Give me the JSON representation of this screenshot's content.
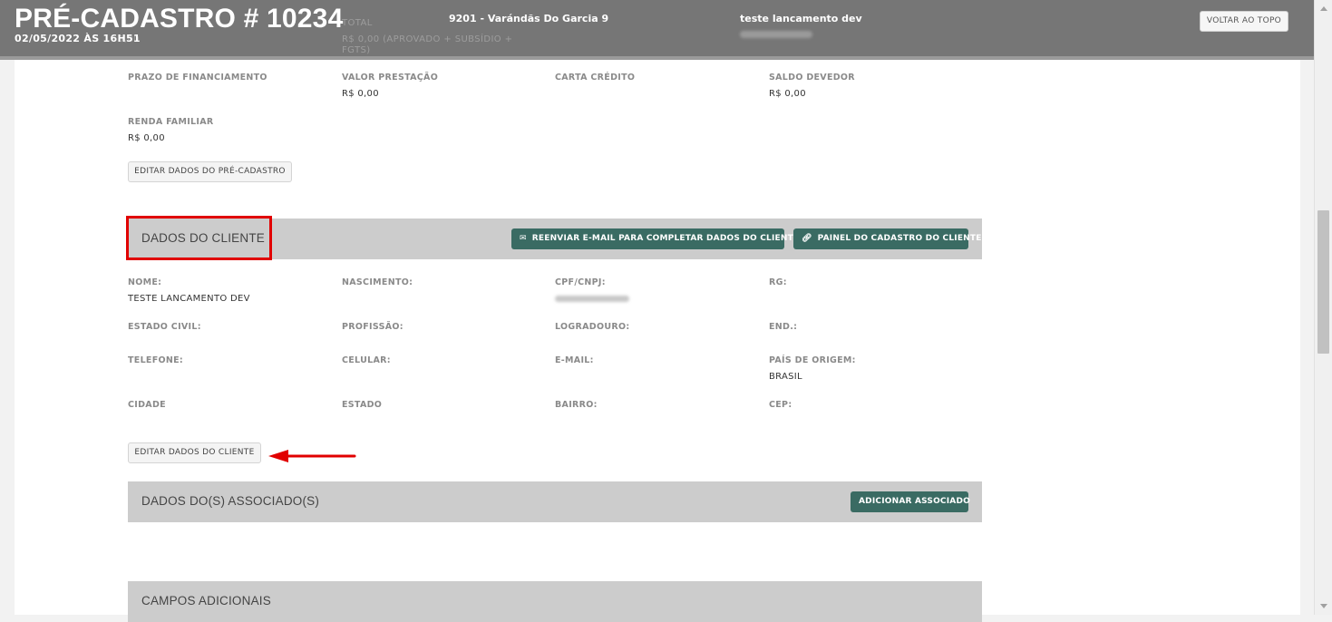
{
  "header": {
    "title": "PRÉ-CADASTRO # 10234",
    "date": "02/05/2022 ÀS 16H51",
    "ghost_total_label": "TOTAL",
    "ghost_value_left": "0,00",
    "ghost_total_value": "R$ 0,00 (APROVADO + SUBSÍDIO + FGTS)",
    "empreendimento": "9201 - Varándãs Do Garcia 9",
    "user_name": "teste lancamento dev",
    "back_to_top": "VOLTAR AO TOPO"
  },
  "financing": {
    "fields": [
      {
        "label": "PRAZO DE FINANCIAMENTO",
        "value": ""
      },
      {
        "label": "VALOR PRESTAÇÃO",
        "value": "R$ 0,00"
      },
      {
        "label": "CARTA CRÉDITO",
        "value": ""
      },
      {
        "label": "SALDO DEVEDOR",
        "value": "R$ 0,00"
      },
      {
        "label": "RENDA FAMILIAR",
        "value": "R$ 0,00"
      }
    ],
    "edit_button": "EDITAR DADOS DO PRÉ-CADASTRO"
  },
  "client": {
    "section_title": "DADOS DO CLIENTE",
    "resend_email_button": "REENVIAR E-MAIL PARA COMPLETAR DADOS DO CLIENTE.",
    "panel_button": "PAINEL DO CADASTRO DO CLIENTE",
    "fields": [
      {
        "label": "NOME:",
        "value": "TESTE LANCAMENTO DEV"
      },
      {
        "label": "NASCIMENTO:",
        "value": ""
      },
      {
        "label": "CPF/CNPJ:",
        "value": ""
      },
      {
        "label": "RG:",
        "value": ""
      },
      {
        "label": "ESTADO CIVIL:",
        "value": ""
      },
      {
        "label": "PROFISSÃO:",
        "value": ""
      },
      {
        "label": "LOGRADOURO:",
        "value": ""
      },
      {
        "label": "END.:",
        "value": ""
      },
      {
        "label": "TELEFONE:",
        "value": ""
      },
      {
        "label": "CELULAR:",
        "value": ""
      },
      {
        "label": "E-MAIL:",
        "value": ""
      },
      {
        "label": "PAÍS DE ORIGEM:",
        "value": "BRASIL"
      },
      {
        "label": "CIDADE",
        "value": ""
      },
      {
        "label": "ESTADO",
        "value": ""
      },
      {
        "label": "BAIRRO:",
        "value": ""
      },
      {
        "label": "CEP:",
        "value": ""
      }
    ],
    "edit_button": "EDITAR DADOS DO CLIENTE"
  },
  "associates": {
    "section_title": "DADOS DO(S) ASSOCIADO(S)",
    "add_button": "ADICIONAR ASSOCIADO"
  },
  "additional": {
    "section_title": "CAMPOS ADICIONAIS"
  },
  "colors": {
    "header_bg": "#767676",
    "accent_green": "#3a6b63",
    "section_bg": "#cccccc",
    "highlight_red": "#e10000"
  }
}
